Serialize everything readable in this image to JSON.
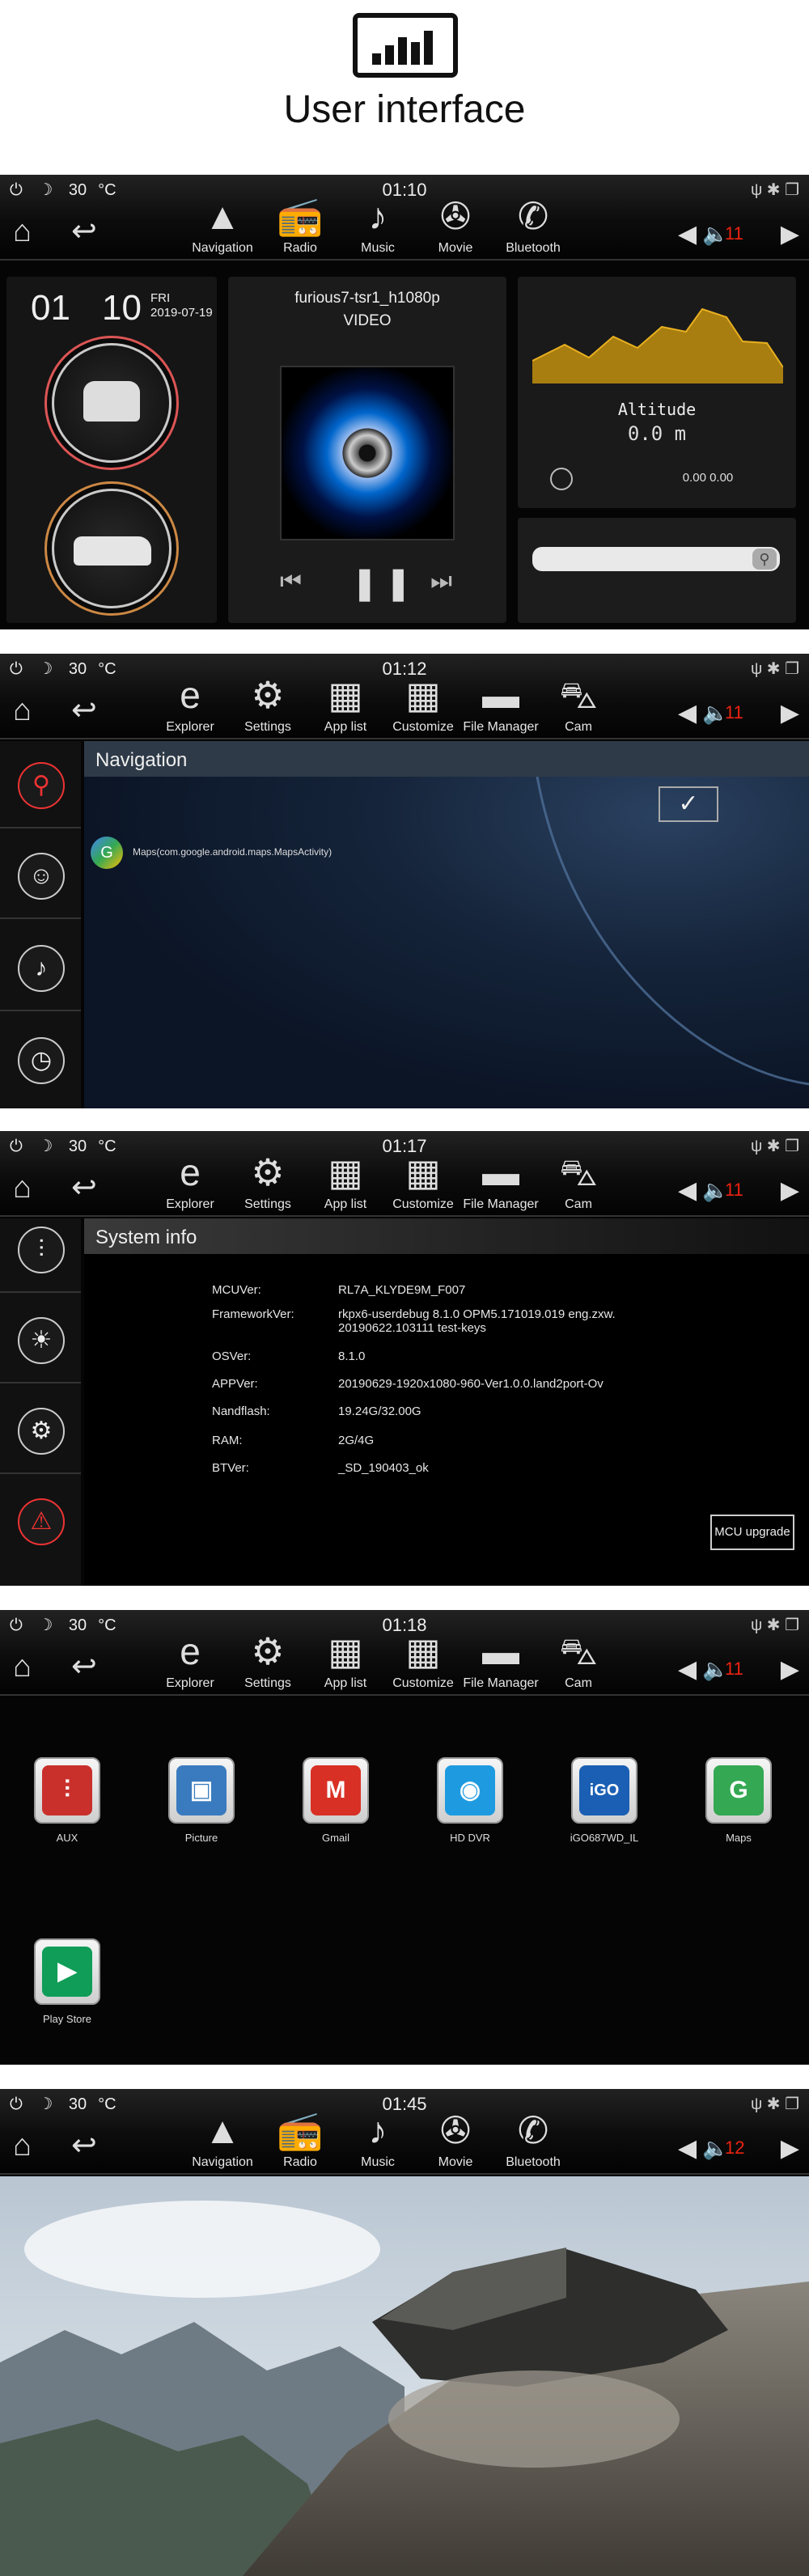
{
  "header": {
    "title": "User interface"
  },
  "screens": {
    "s1": {
      "status": {
        "temp": "30",
        "unit": "°C",
        "time": "01:10"
      },
      "volume": "11",
      "dock": [
        {
          "label": "Navigation",
          "icon": "navigation-arrow-icon"
        },
        {
          "label": "Radio",
          "icon": "radio-icon"
        },
        {
          "label": "Music",
          "icon": "music-note-icon"
        },
        {
          "label": "Movie",
          "icon": "film-reel-icon"
        },
        {
          "label": "Bluetooth",
          "icon": "phone-icon"
        }
      ],
      "date": {
        "month": "01",
        "day": "10",
        "weekday": "FRI",
        "full": "2019-07-19"
      },
      "media": {
        "title": "furious7-tsr1_h1080p",
        "type": "VIDEO"
      },
      "altitude": {
        "label": "Altitude",
        "value": "0.0 m",
        "coords": "0.00  0.00"
      }
    },
    "s2": {
      "status": {
        "temp": "30",
        "unit": "°C",
        "time": "01:12"
      },
      "volume": "11",
      "dock": [
        {
          "label": "Explorer",
          "icon": "explorer-icon"
        },
        {
          "label": "Settings",
          "icon": "gear-icon"
        },
        {
          "label": "App list",
          "icon": "grid-icon"
        },
        {
          "label": "Customize",
          "icon": "app-grid-icon"
        },
        {
          "label": "File Manager",
          "icon": "folder-icon"
        },
        {
          "label": "Cam",
          "icon": "car-icon"
        }
      ],
      "title": "Navigation",
      "item": "Maps(com.google.android.maps.MapsActivity)"
    },
    "s3": {
      "status": {
        "temp": "30",
        "unit": "°C",
        "time": "01:17"
      },
      "volume": "11",
      "title": "System info",
      "rows": [
        {
          "k": "MCUVer:",
          "v": "RL7A_KLYDE9M_F007"
        },
        {
          "k": "FrameworkVer:",
          "v": "rkpx6-userdebug 8.1.0 OPM5.171019.019 eng.zxw. 20190622.103111 test-keys"
        },
        {
          "k": "OSVer:",
          "v": "8.1.0"
        },
        {
          "k": "APPVer:",
          "v": "20190629-1920x1080-960-Ver1.0.0.land2port-Ov"
        },
        {
          "k": "Nandflash:",
          "v": "19.24G/32.00G"
        },
        {
          "k": "RAM:",
          "v": "2G/4G"
        },
        {
          "k": "BTVer:",
          "v": "_SD_190403_ok"
        }
      ],
      "button": "MCU upgrade"
    },
    "s4": {
      "status": {
        "temp": "30",
        "unit": "°C",
        "time": "01:18"
      },
      "volume": "11",
      "apps": [
        {
          "label": "AUX",
          "icon": "aux-icon",
          "color": "#c9302c"
        },
        {
          "label": "Picture",
          "icon": "picture-icon",
          "color": "#3a7bbf"
        },
        {
          "label": "Gmail",
          "icon": "gmail-icon",
          "color": "#d93025"
        },
        {
          "label": "HD DVR",
          "icon": "dvr-camera-icon",
          "color": "#1e9be0"
        },
        {
          "label": "iGO687WD_IL",
          "icon": "igo-icon",
          "color": "#1a5fb4"
        },
        {
          "label": "Maps",
          "icon": "maps-icon",
          "color": "#34a853"
        },
        {
          "label": "Play Store",
          "icon": "play-store-icon",
          "color": "#0f9d58"
        }
      ]
    },
    "s5": {
      "status": {
        "temp": "30",
        "unit": "°C",
        "time": "01:45"
      },
      "volume": "12"
    }
  }
}
